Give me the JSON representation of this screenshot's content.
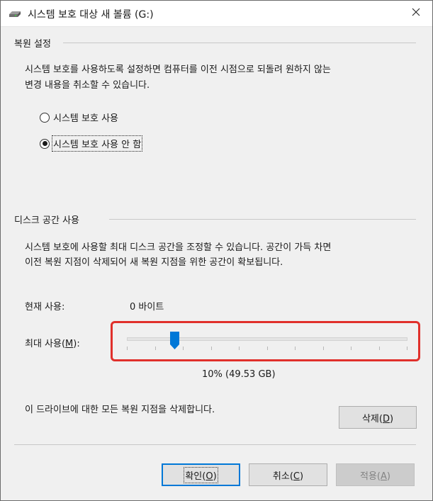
{
  "window": {
    "title": "시스템 보호 대상 새 볼륨 (G:)",
    "icon": "drive-icon",
    "close_icon": "close-icon"
  },
  "restore_settings": {
    "header": "복원 설정",
    "description_line1": "시스템 보호를 사용하도록 설정하면 컴퓨터를 이전 시점으로 되돌려 원하지 않는",
    "description_line2": "변경 내용을 취소할 수 있습니다.",
    "options": [
      {
        "label": "시스템 보호 사용",
        "checked": false
      },
      {
        "label": "시스템 보호 사용 안 함",
        "checked": true
      }
    ]
  },
  "disk_space": {
    "header": "디스크 공간 사용",
    "description_line1": "시스템 보호에 사용할 최대 디스크 공간을 조정할 수 있습니다. 공간이 가득 차면",
    "description_line2": "이전 복원 지점이 삭제되어 새 복원 지점을 위한 공간이 확보됩니다.",
    "current_usage_label": "현재 사용:",
    "current_usage_value": "0 바이트",
    "max_usage_label_prefix": "최대 사용(",
    "max_usage_label_key": "M",
    "max_usage_label_suffix": "):",
    "slider_percent": 10,
    "slider_value_text": "10% (49.53 GB)",
    "accent_color": "#0078d7",
    "highlight_color": "#e0302b"
  },
  "delete": {
    "description": "이 드라이브에 대한 모든 복원 지점을 삭제합니다.",
    "button_prefix": "삭제(",
    "button_key": "D",
    "button_suffix": ")"
  },
  "buttons": {
    "ok_prefix": "확인(",
    "ok_key": "O",
    "ok_suffix": ")",
    "cancel_prefix": "취소(",
    "cancel_key": "C",
    "cancel_suffix": ")",
    "apply_prefix": "적용(",
    "apply_key": "A",
    "apply_suffix": ")"
  }
}
